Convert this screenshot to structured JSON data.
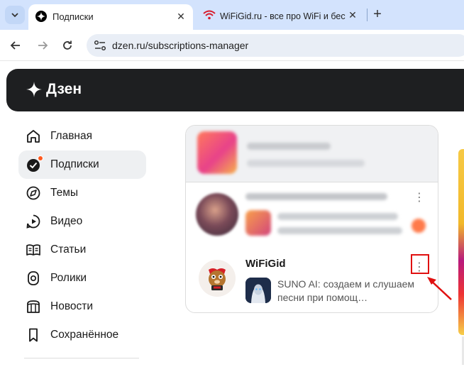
{
  "browser": {
    "active_tab": {
      "title": "Подписки"
    },
    "inactive_tab": {
      "title": "WiFiGid.ru - все про WiFi и бес"
    },
    "address": "dzen.ru/subscriptions-manager"
  },
  "header": {
    "brand": "Дзен"
  },
  "sidebar": {
    "items": [
      {
        "label": "Главная",
        "icon": "home-icon"
      },
      {
        "label": "Подписки",
        "icon": "subscriptions-icon",
        "active": true,
        "badge": true
      },
      {
        "label": "Темы",
        "icon": "compass-icon"
      },
      {
        "label": "Видео",
        "icon": "video-icon"
      },
      {
        "label": "Статьи",
        "icon": "book-icon"
      },
      {
        "label": "Ролики",
        "icon": "shorts-icon"
      },
      {
        "label": "Новости",
        "icon": "news-icon"
      },
      {
        "label": "Сохранённое",
        "icon": "bookmark-icon"
      }
    ]
  },
  "subscriptions": {
    "channel": {
      "name": "WiFiGid",
      "latest_video_title": "SUNO AI: создаем и слушаем песни при помощ…"
    }
  },
  "colors": {
    "accent_red": "#e01010",
    "header_bg": "#1e1f21",
    "badge_orange": "#ff5a1f",
    "tab_strip": "#d3e3fd"
  }
}
